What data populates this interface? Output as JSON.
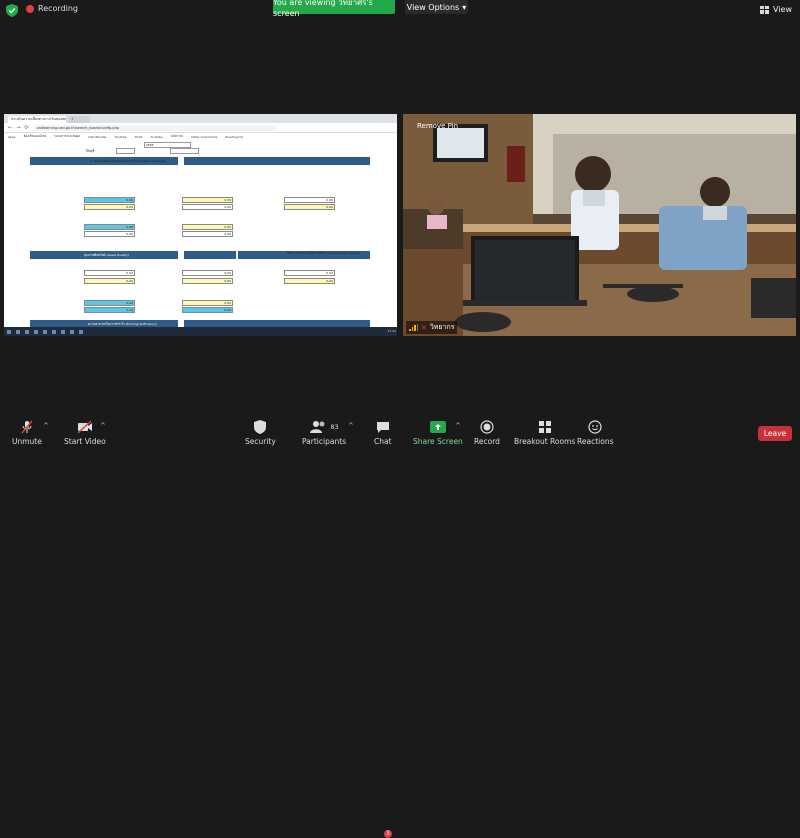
{
  "top": {
    "recording_label": "Recording",
    "viewing_banner": "You are viewing วิทยาศร's screen",
    "view_options": "View Options",
    "view_label": "View"
  },
  "shared_screen": {
    "tab_title": "ประเมินความเสี่ยงทางการเงินของสหกรณ์",
    "url": "cadlearning.cad.go.th/search_board/config.php",
    "bookmarks": [
      "Apps",
      "ห้องเรียนออนไลน์",
      "ระบบการประเมินผล",
      "CAD Moodle",
      "YouTube",
      "TCAS",
      "YouTube",
      "นวัตกรรม",
      "Other bookmarks",
      "Reading list"
    ],
    "year_label": "ปีบัญชี",
    "year_value": "2565",
    "section1": "ความเพียงพอของเงินทุนต่อความเสี่ยง (Capital Strength)",
    "section2": "คุณภาพสินทรัพย์ (Asset Quality)",
    "section3": "ขีดความสามารถในการบริหาร (Management Ability)",
    "section4": "ความสามารถในการทำกำไร (Earning Sufficiency)",
    "field_zero": "0.00",
    "taskbar_time": "17:41"
  },
  "video": {
    "remove_pin": "Remove Pin",
    "participant_name": "วิทยากร"
  },
  "toolbar": {
    "unmute": "Unmute",
    "start_video": "Start Video",
    "security": "Security",
    "participants": "Participants",
    "participants_count": "83",
    "chat": "Chat",
    "chat_badge": "3",
    "share_screen": "Share Screen",
    "record": "Record",
    "breakout_rooms": "Breakout Rooms",
    "reactions": "Reactions",
    "leave": "Leave"
  },
  "colors": {
    "share_green": "#23a84a",
    "leave_red": "#c8303a",
    "section_blue": "#2f5d8a"
  }
}
